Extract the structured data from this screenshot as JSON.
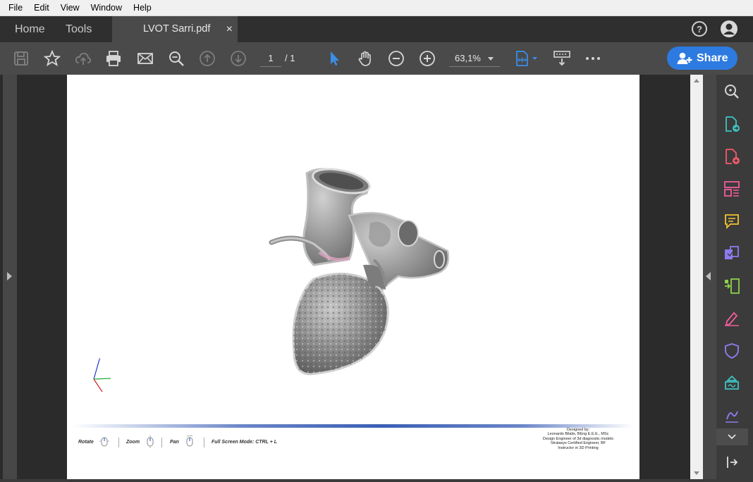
{
  "menu": {
    "file": "File",
    "edit": "Edit",
    "view": "View",
    "window": "Window",
    "help": "Help"
  },
  "tabs": {
    "home": "Home",
    "tools": "Tools",
    "document": "LVOT Sarri.pdf",
    "close": "×"
  },
  "toolbar": {
    "page_current": "1",
    "page_total": "/ 1",
    "zoom": "63,1%",
    "share_label": "Share"
  },
  "colors": {
    "accent": "#2d7be0",
    "toolbar_bg": "#4a4a4a",
    "tabbar_bg": "#2f2f2f",
    "viewer_bg": "#2b2b2b"
  },
  "document": {
    "controls": {
      "rotate": "Rotate",
      "zoom": "Zoom",
      "pan": "Pan",
      "fullscreen": "Full Screen Mode:  CTRL + L"
    },
    "credits": [
      "Designed by:",
      "Leonardo Bilalis, BEng E.E.E., MSc",
      "Design Engineer of 3d diagnostic models",
      "Stratasys Certified Engineer, BF",
      "Instructor in 3D Printing"
    ]
  },
  "icons": {
    "toolbar": [
      "save-icon",
      "bookmark-star-icon",
      "cloud-upload-icon",
      "print-icon",
      "email-icon",
      "find-icon",
      "prev-page-icon",
      "next-page-icon",
      "select-cursor-icon",
      "hand-pan-icon",
      "zoom-out-icon",
      "zoom-in-icon",
      "fit-page-icon",
      "scroll-mode-icon",
      "more-icon"
    ],
    "right_panel": [
      "zoom-pane-icon",
      "export-pdf-icon",
      "create-pdf-icon",
      "organize-pages-icon",
      "comment-icon",
      "combine-files-icon",
      "compress-icon",
      "fill-sign-icon",
      "protect-icon",
      "send-signature-icon",
      "request-sign-icon",
      "collapse-icon",
      "expand-panel-icon"
    ]
  }
}
